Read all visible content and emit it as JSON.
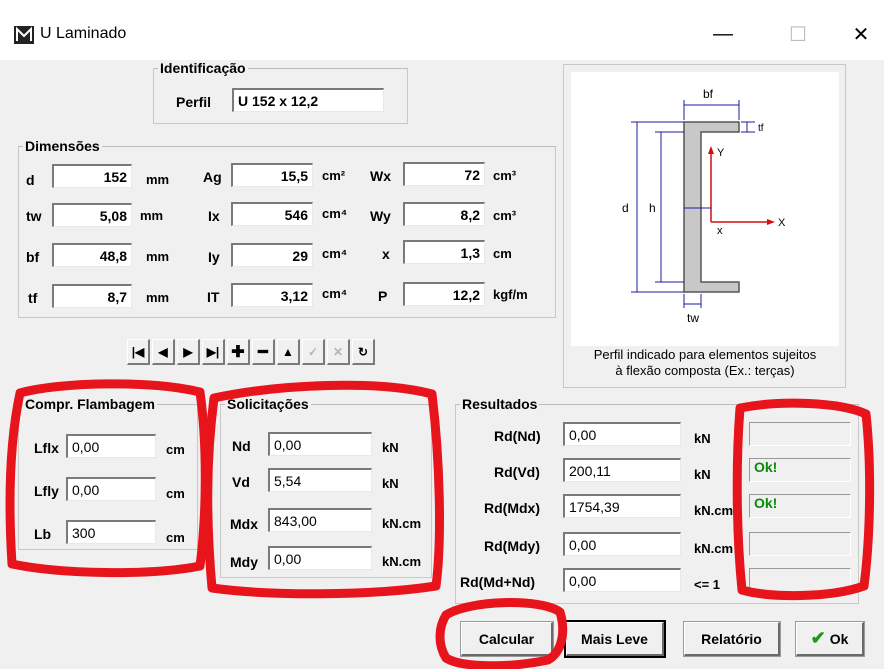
{
  "window": {
    "title": "U Laminado",
    "minimize_glyph": "—",
    "maximize_glyph": "☐",
    "close_glyph": "✕"
  },
  "identificacao": {
    "legend": "Identificação",
    "perfil_label": "Perfil",
    "perfil_value": "U 152 x 12,2"
  },
  "dimensoes": {
    "legend": "Dimensões",
    "d": {
      "label": "d",
      "value": "152",
      "unit": "mm"
    },
    "tw": {
      "label": "tw",
      "value": "5,08",
      "unit": "mm"
    },
    "bf": {
      "label": "bf",
      "value": "48,8",
      "unit": "mm"
    },
    "tf": {
      "label": "tf",
      "value": "8,7",
      "unit": "mm"
    },
    "ag": {
      "label": "Ag",
      "value": "15,5",
      "unit": "cm²"
    },
    "ix": {
      "label": "Ix",
      "value": "546",
      "unit": "cm⁴"
    },
    "iy": {
      "label": "Iy",
      "value": "29",
      "unit": "cm⁴"
    },
    "it": {
      "label": "IT",
      "value": "3,12",
      "unit": "cm⁴"
    },
    "wx": {
      "label": "Wx",
      "value": "72",
      "unit": "cm³"
    },
    "wy": {
      "label": "Wy",
      "value": "8,2",
      "unit": "cm³"
    },
    "x": {
      "label": "x",
      "value": "1,3",
      "unit": "cm"
    },
    "p": {
      "label": "P",
      "value": "12,2",
      "unit": "kgf/m"
    }
  },
  "navigator": {
    "buttons": [
      "first",
      "prior",
      "next",
      "last",
      "insert",
      "delete",
      "edit",
      "post",
      "cancel",
      "refresh"
    ]
  },
  "picture": {
    "labels": {
      "bf": "bf",
      "tf": "tf",
      "d": "d",
      "h": "h",
      "tw": "tw",
      "x_axis": "X",
      "y_axis": "Y",
      "x_dist": "x"
    },
    "caption_line1": "Perfil indicado para elementos sujeitos",
    "caption_line2": "à flexão composta (Ex.: terças)"
  },
  "flambagem": {
    "legend": "Compr. Flambagem",
    "lflx": {
      "label": "Lflx",
      "value": "0,00",
      "unit": "cm"
    },
    "lfly": {
      "label": "Lfly",
      "value": "0,00",
      "unit": "cm"
    },
    "lb": {
      "label": "Lb",
      "value": "300",
      "unit": "cm"
    }
  },
  "solicitacoes": {
    "legend": "Solicitações",
    "nd": {
      "label": "Nd",
      "value": "0,00",
      "unit": "kN"
    },
    "vd": {
      "label": "Vd",
      "value": "5,54",
      "unit": "kN"
    },
    "mdx": {
      "label": "Mdx",
      "value": "843,00",
      "unit": "kN.cm"
    },
    "mdy": {
      "label": "Mdy",
      "value": "0,00",
      "unit": "kN.cm"
    }
  },
  "resultados": {
    "legend": "Resultados",
    "rows": [
      {
        "label": "Rd(Nd)",
        "value": "0,00",
        "unit": "kN",
        "status": ""
      },
      {
        "label": "Rd(Vd)",
        "value": "200,11",
        "unit": "kN",
        "status": "Ok!"
      },
      {
        "label": "Rd(Mdx)",
        "value": "1754,39",
        "unit": "kN.cm",
        "status": "Ok!"
      },
      {
        "label": "Rd(Mdy)",
        "value": "0,00",
        "unit": "kN.cm",
        "status": ""
      },
      {
        "label": "Rd(Md+Nd)",
        "value": "0,00",
        "unit": "<= 1",
        "status": ""
      }
    ]
  },
  "buttons": {
    "calcular": "Calcular",
    "mais_leve": "Mais Leve",
    "relatorio": "Relatório",
    "ok": "Ok"
  },
  "colors": {
    "annotation": "#e8141c",
    "ok_text": "#0a8a0a",
    "profile_fill": "#c8c8c8",
    "dimension_lines": "#1a1aa0"
  }
}
